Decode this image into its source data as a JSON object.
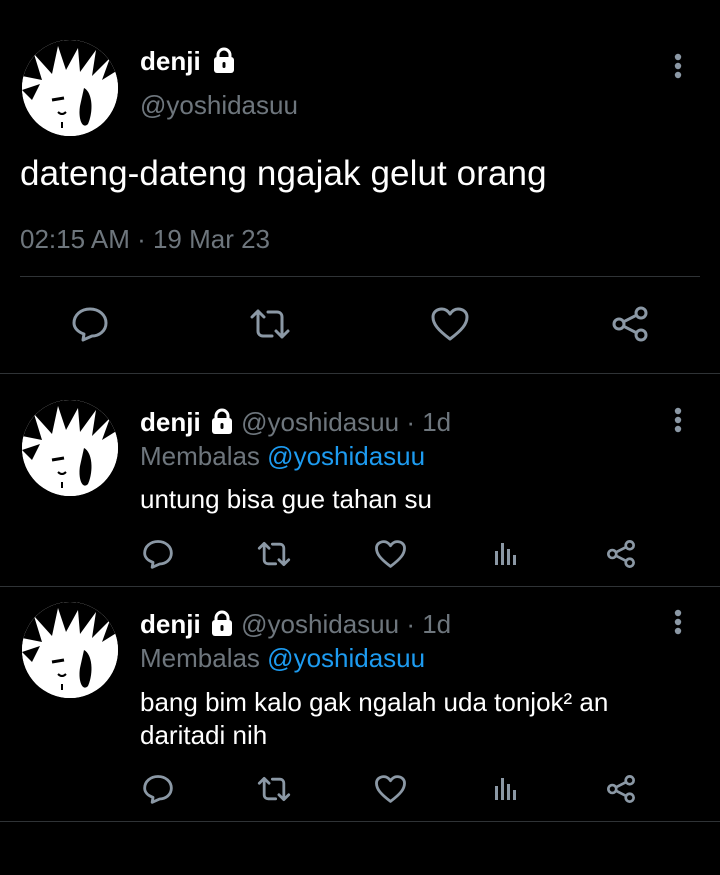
{
  "main_tweet": {
    "display_name": "denji",
    "handle": "@yoshidasuu",
    "text": "dateng-dateng ngajak gelut orang",
    "timestamp": "02:15 AM · 19 Mar 23",
    "actions": [
      "reply-icon",
      "retweet-icon",
      "like-icon",
      "share-icon"
    ]
  },
  "replies": [
    {
      "display_name": "denji",
      "handle": "@yoshidasuu",
      "age": "· 1d",
      "replying_prefix": "Membalas",
      "replying_to": "@yoshidasuu",
      "text_lines": [
        "untung bisa gue tahan su"
      ],
      "actions": [
        "reply-icon",
        "retweet-icon",
        "like-icon",
        "analytics-icon",
        "share-icon"
      ]
    },
    {
      "display_name": "denji",
      "handle": "@yoshidasuu",
      "age": "· 1d",
      "replying_prefix": "Membalas",
      "replying_to": "@yoshidasuu",
      "text_lines": [
        "bang bim kalo gak ngalah uda tonjok² an",
        "daritadi nih"
      ],
      "actions": [
        "reply-icon",
        "retweet-icon",
        "like-icon",
        "analytics-icon",
        "share-icon"
      ]
    }
  ],
  "colors": {
    "background": "#000000",
    "text": "#e7e9ea",
    "muted": "#6e767d",
    "link": "#1d9bf0",
    "divider": "#2f3336"
  }
}
